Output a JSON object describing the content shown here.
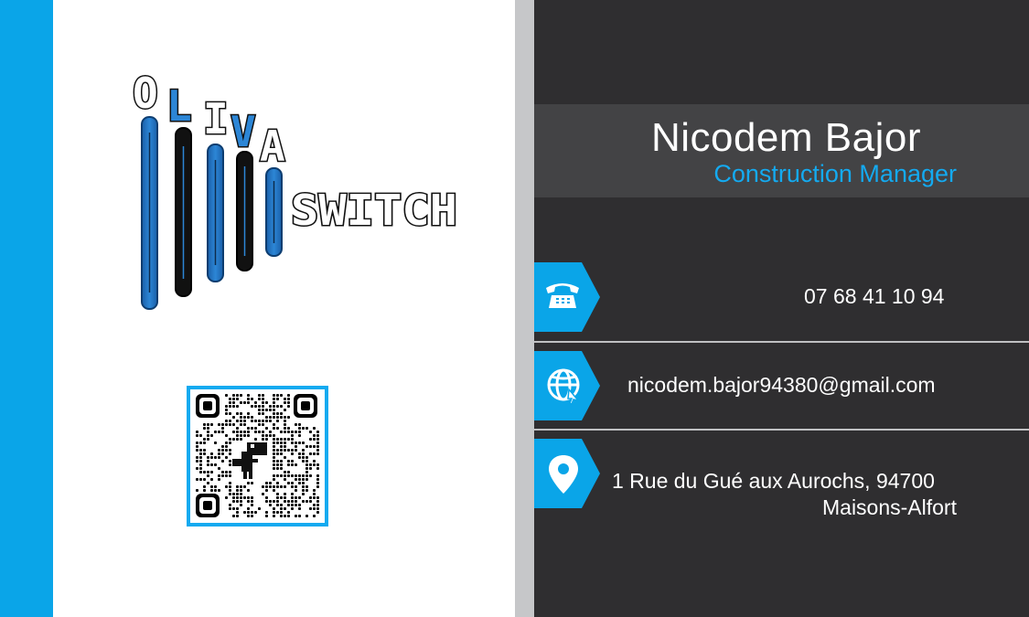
{
  "card": {
    "logo": {
      "line1": "OLIVA",
      "line2": "SWITCH",
      "logo_icon": "equalizer-bars-logo"
    },
    "qr_code": {
      "icon": "qr-code-with-dino-icon"
    },
    "person": {
      "name": "Nicodem Bajor",
      "title": "Construction Manager"
    },
    "contacts": {
      "phone": {
        "icon": "telephone-icon",
        "value": "07 68 41 10 94"
      },
      "email": {
        "icon": "globe-cursor-icon",
        "value": "nicodem.bajor94380@gmail.com"
      },
      "address": {
        "icon": "map-pin-icon",
        "line1": "1 Rue du Gué aux Aurochs, 94700",
        "line2": "Maisons-Alfort"
      }
    },
    "colors": {
      "accent_blue": "#0aa5e8",
      "title_blue": "#14aaf0",
      "dark_panel": "#2f2e30",
      "name_band": "#434345",
      "divider_grey": "#c6c7c9",
      "logo_blue": "#1d6fb8"
    }
  }
}
